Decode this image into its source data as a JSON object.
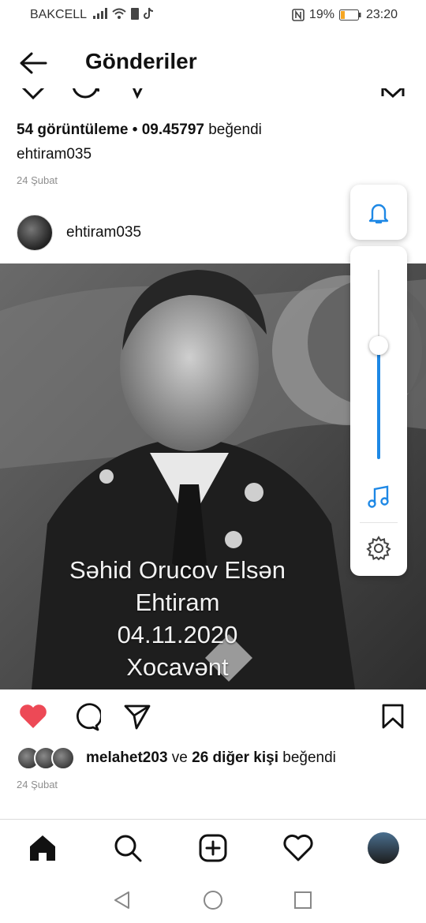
{
  "status_bar": {
    "carrier": "BAKCELL",
    "battery_percent": "19%",
    "time": "23:20"
  },
  "header": {
    "title": "Gönderiler"
  },
  "previous_post": {
    "views_count": "54 görüntüleme",
    "views_sep": " • ",
    "likes_count": "09.45797",
    "likes_suffix": " beğendi",
    "caption_user": "ehtiram035",
    "date": "24 Şubat"
  },
  "post": {
    "username": "ehtiram035",
    "image_text": {
      "line1": "Səhid Orucov Elsən",
      "line2": "Ehtiram",
      "line3": "04.11.2020",
      "line4": "Xocavənt"
    },
    "liked_by_user": "melahet203",
    "liked_by_mid": " ve ",
    "liked_by_others": "26 diğer kişi",
    "liked_by_suffix": " beğendi",
    "date": "24 Şubat"
  },
  "volume_panel": {
    "level": 0.6
  },
  "colors": {
    "like_red": "#ed4956",
    "accent_blue": "#1e88e5"
  }
}
